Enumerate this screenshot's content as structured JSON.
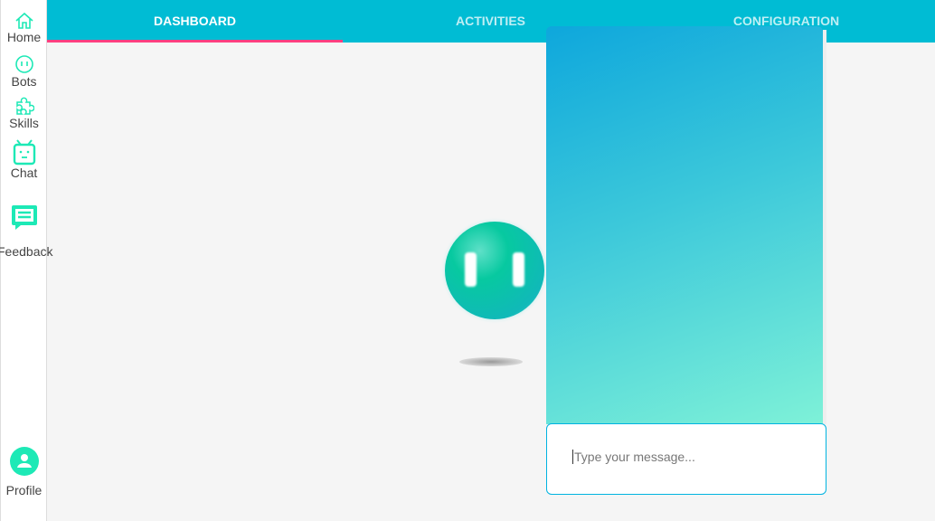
{
  "sidebar": {
    "items": [
      {
        "label": "Home",
        "icon": "home-icon"
      },
      {
        "label": "Bots",
        "icon": "bot-face-icon"
      },
      {
        "label": "Skills",
        "icon": "puzzle-icon"
      },
      {
        "label": "Chat",
        "icon": "robot-icon"
      },
      {
        "label": "Feedback",
        "icon": "feedback-icon"
      },
      {
        "label": "Profile",
        "icon": "profile-icon"
      }
    ],
    "accent": "#1de9b6"
  },
  "tabs": [
    {
      "label": "DASHBOARD",
      "active": true
    },
    {
      "label": "ACTIVITIES"
    },
    {
      "label": "CONFIGURATION"
    }
  ],
  "colors": {
    "topbar": "#00bcd4",
    "indicator": "#ff4081"
  },
  "chat": {
    "placeholder": "Type your message..."
  }
}
